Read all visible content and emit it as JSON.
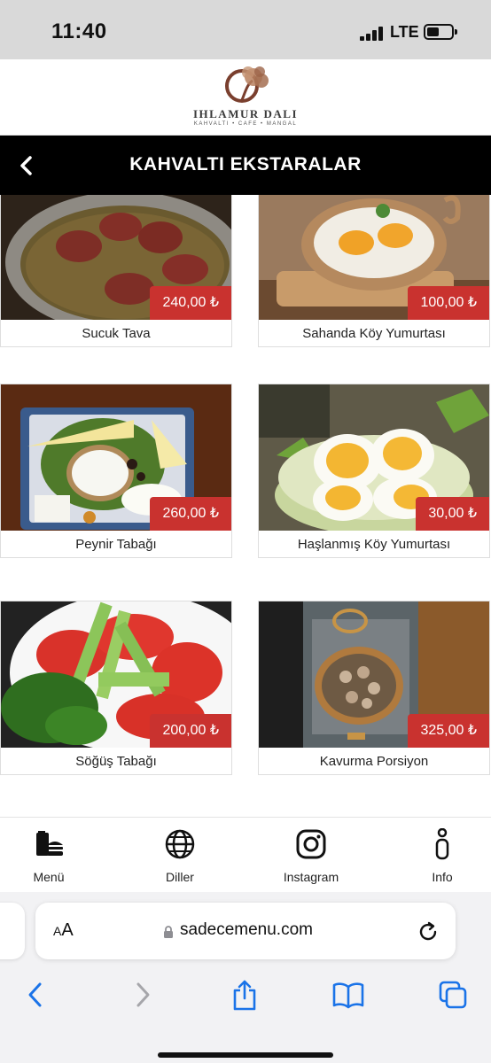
{
  "status_bar": {
    "time": "11:40",
    "network": "LTE"
  },
  "brand": {
    "name": "IHLAMUR DALI",
    "tagline": "KAHVALTI • CAFE • MANGAL"
  },
  "header": {
    "title": "KAHVALTI EKSTARALAR"
  },
  "products": [
    {
      "name": "Sucuk Tava",
      "price": "240,00 ₺"
    },
    {
      "name": "Sahanda Köy Yumurtası",
      "price": "100,00 ₺"
    },
    {
      "name": "Peynir Tabağı",
      "price": "260,00 ₺"
    },
    {
      "name": "Haşlanmış Köy Yumurtası",
      "price": "30,00 ₺"
    },
    {
      "name": "Söğüş Tabağı",
      "price": "200,00 ₺"
    },
    {
      "name": "Kavurma Porsiyon",
      "price": "325,00 ₺"
    }
  ],
  "bottom_nav": [
    {
      "label": "Menü",
      "icon": "burger-menu-icon"
    },
    {
      "label": "Diller",
      "icon": "globe-icon"
    },
    {
      "label": "Instagram",
      "icon": "instagram-icon"
    },
    {
      "label": "Info",
      "icon": "info-icon"
    }
  ],
  "browser": {
    "text_size_label": "AA",
    "url": "sadecemenu.com"
  },
  "colors": {
    "price_badge": "#c9322f",
    "title_bar": "#000000",
    "browser_accent": "#1a73e8"
  }
}
